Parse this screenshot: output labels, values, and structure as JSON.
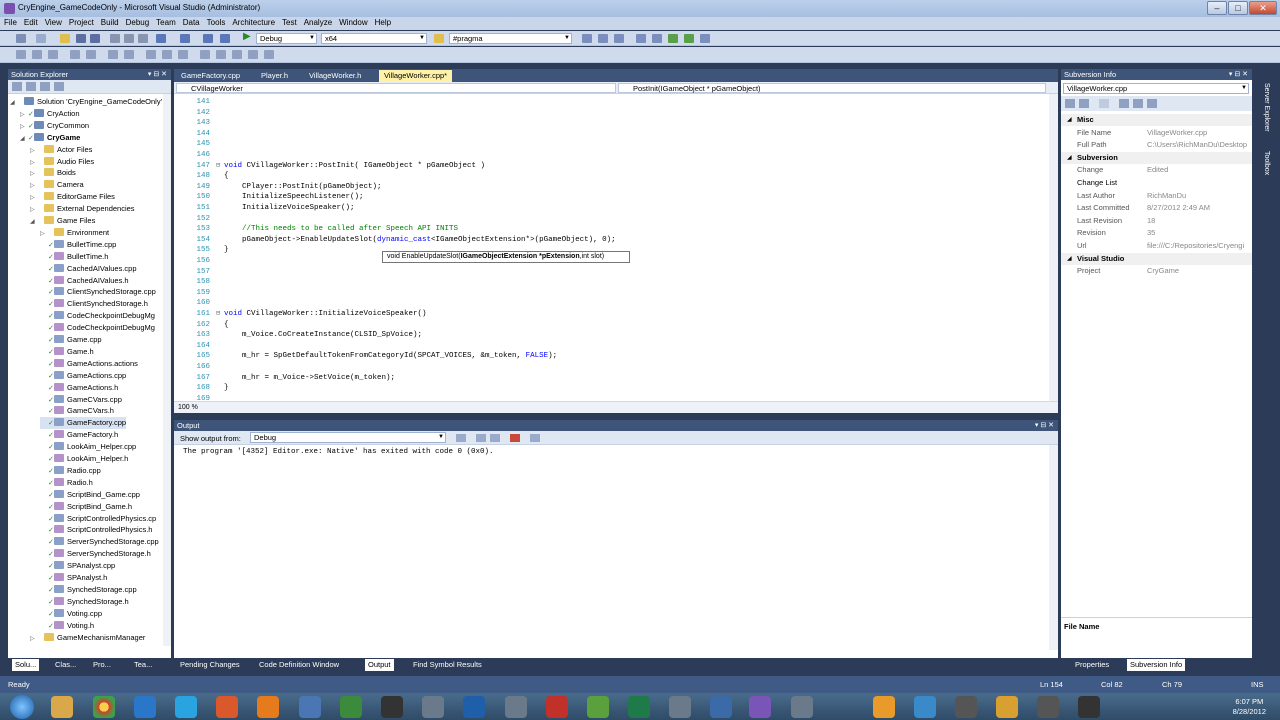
{
  "window": {
    "title": "CryEngine_GameCodeOnly - Microsoft Visual Studio (Administrator)"
  },
  "menu": [
    "File",
    "Edit",
    "View",
    "Project",
    "Build",
    "Debug",
    "Team",
    "Data",
    "Tools",
    "Architecture",
    "Test",
    "Analyze",
    "Window",
    "Help"
  ],
  "toolbar": {
    "config": "Debug",
    "platform": "x64",
    "find": "#pragma"
  },
  "solution_explorer": {
    "title": "Solution Explorer",
    "items": [
      {
        "label": "Solution 'CryEngine_GameCodeOnly' (3",
        "level": 0,
        "type": "proj",
        "expanded": true
      },
      {
        "label": "CryAction",
        "level": 1,
        "type": "proj",
        "check": true
      },
      {
        "label": "CryCommon",
        "level": 1,
        "type": "proj",
        "check": true
      },
      {
        "label": "CryGame",
        "level": 1,
        "type": "proj",
        "check": true,
        "expanded": true,
        "bold": true
      },
      {
        "label": "Actor Files",
        "level": 2,
        "type": "folder"
      },
      {
        "label": "Audio Files",
        "level": 2,
        "type": "folder"
      },
      {
        "label": "Boids",
        "level": 2,
        "type": "folder"
      },
      {
        "label": "Camera",
        "level": 2,
        "type": "folder"
      },
      {
        "label": "EditorGame Files",
        "level": 2,
        "type": "folder"
      },
      {
        "label": "External Dependencies",
        "level": 2,
        "type": "folder"
      },
      {
        "label": "Game Files",
        "level": 2,
        "type": "folder",
        "expanded": true
      },
      {
        "label": "Environment",
        "level": 3,
        "type": "folder"
      },
      {
        "label": "BulletTime.cpp",
        "level": 3,
        "type": "cpp",
        "check": true
      },
      {
        "label": "BulletTime.h",
        "level": 3,
        "type": "hfile",
        "check": true
      },
      {
        "label": "CachedAIValues.cpp",
        "level": 3,
        "type": "cpp",
        "check": true
      },
      {
        "label": "CachedAIValues.h",
        "level": 3,
        "type": "hfile",
        "check": true
      },
      {
        "label": "ClientSynchedStorage.cpp",
        "level": 3,
        "type": "cpp",
        "check": true
      },
      {
        "label": "ClientSynchedStorage.h",
        "level": 3,
        "type": "hfile",
        "check": true
      },
      {
        "label": "CodeCheckpointDebugMg",
        "level": 3,
        "type": "cpp",
        "check": true
      },
      {
        "label": "CodeCheckpointDebugMg",
        "level": 3,
        "type": "hfile",
        "check": true
      },
      {
        "label": "Game.cpp",
        "level": 3,
        "type": "cpp",
        "check": true
      },
      {
        "label": "Game.h",
        "level": 3,
        "type": "hfile",
        "check": true
      },
      {
        "label": "GameActions.actions",
        "level": 3,
        "type": "hfile",
        "check": true
      },
      {
        "label": "GameActions.cpp",
        "level": 3,
        "type": "cpp",
        "check": true
      },
      {
        "label": "GameActions.h",
        "level": 3,
        "type": "hfile",
        "check": true
      },
      {
        "label": "GameCVars.cpp",
        "level": 3,
        "type": "cpp",
        "check": true
      },
      {
        "label": "GameCVars.h",
        "level": 3,
        "type": "hfile",
        "check": true
      },
      {
        "label": "GameFactory.cpp",
        "level": 3,
        "type": "cpp",
        "check": true,
        "selected": true
      },
      {
        "label": "GameFactory.h",
        "level": 3,
        "type": "hfile",
        "check": true
      },
      {
        "label": "LookAim_Helper.cpp",
        "level": 3,
        "type": "cpp",
        "check": true
      },
      {
        "label": "LookAim_Helper.h",
        "level": 3,
        "type": "hfile",
        "check": true
      },
      {
        "label": "Radio.cpp",
        "level": 3,
        "type": "cpp",
        "check": true
      },
      {
        "label": "Radio.h",
        "level": 3,
        "type": "hfile",
        "check": true
      },
      {
        "label": "ScriptBind_Game.cpp",
        "level": 3,
        "type": "cpp",
        "check": true
      },
      {
        "label": "ScriptBind_Game.h",
        "level": 3,
        "type": "hfile",
        "check": true
      },
      {
        "label": "ScriptControlledPhysics.cp",
        "level": 3,
        "type": "cpp",
        "check": true
      },
      {
        "label": "ScriptControlledPhysics.h",
        "level": 3,
        "type": "hfile",
        "check": true
      },
      {
        "label": "ServerSynchedStorage.cpp",
        "level": 3,
        "type": "cpp",
        "check": true
      },
      {
        "label": "ServerSynchedStorage.h",
        "level": 3,
        "type": "hfile",
        "check": true
      },
      {
        "label": "SPAnalyst.cpp",
        "level": 3,
        "type": "cpp",
        "check": true
      },
      {
        "label": "SPAnalyst.h",
        "level": 3,
        "type": "hfile",
        "check": true
      },
      {
        "label": "SynchedStorage.cpp",
        "level": 3,
        "type": "cpp",
        "check": true
      },
      {
        "label": "SynchedStorage.h",
        "level": 3,
        "type": "hfile",
        "check": true
      },
      {
        "label": "Voting.cpp",
        "level": 3,
        "type": "cpp",
        "check": true
      },
      {
        "label": "Voting.h",
        "level": 3,
        "type": "hfile",
        "check": true
      },
      {
        "label": "GameMechanismManager",
        "level": 2,
        "type": "folder"
      }
    ],
    "bottom_tabs": [
      "Solu...",
      "Clas...",
      "Pro...",
      "Tea..."
    ]
  },
  "editor": {
    "tabs": [
      "GameFactory.cpp",
      "Player.h",
      "VillageWorker.h",
      "VillageWorker.cpp*"
    ],
    "active_tab": 3,
    "nav_left": "CVillageWorker",
    "nav_right": "PostInit(IGameObject * pGameObject)",
    "zoom": "100 %",
    "tooltip": {
      "prefix": "void EnableUpdateSlot(",
      "bold": "IGameObjectExtension *pExtension",
      "suffix": ",int slot)"
    },
    "lines": [
      {
        "n": "141",
        "t": ""
      },
      {
        "n": "142",
        "t": ""
      },
      {
        "n": "143",
        "t": ""
      },
      {
        "n": "144",
        "t": ""
      },
      {
        "n": "145",
        "t": ""
      },
      {
        "n": "146",
        "t": ""
      },
      {
        "n": "147",
        "t": "void CVillageWorker::PostInit( IGameObject * pGameObject )",
        "fold": true
      },
      {
        "n": "148",
        "t": "{"
      },
      {
        "n": "149",
        "t": "    CPlayer::PostInit(pGameObject);"
      },
      {
        "n": "150",
        "t": "    InitializeSpeechListener();"
      },
      {
        "n": "151",
        "t": "    InitializeVoiceSpeaker();"
      },
      {
        "n": "152",
        "t": ""
      },
      {
        "n": "153",
        "t": "    //This needs to be called after Speech API INITS",
        "comment": true
      },
      {
        "n": "154",
        "t": "    pGameObject->EnableUpdateSlot(dynamic_cast<IGameObjectExtension*>(pGameObject), 0);"
      },
      {
        "n": "155",
        "t": "}"
      },
      {
        "n": "156",
        "t": ""
      },
      {
        "n": "157",
        "t": ""
      },
      {
        "n": "158",
        "t": ""
      },
      {
        "n": "159",
        "t": ""
      },
      {
        "n": "160",
        "t": ""
      },
      {
        "n": "161",
        "t": "void CVillageWorker::InitializeVoiceSpeaker()",
        "fold": true
      },
      {
        "n": "162",
        "t": "{"
      },
      {
        "n": "163",
        "t": "    m_Voice.CoCreateInstance(CLSID_SpVoice);"
      },
      {
        "n": "164",
        "t": ""
      },
      {
        "n": "165",
        "t": "    m_hr = SpGetDefaultTokenFromCategoryId(SPCAT_VOICES, &m_token, FALSE);"
      },
      {
        "n": "166",
        "t": ""
      },
      {
        "n": "167",
        "t": "    m_hr = m_Voice->SetVoice(m_token);"
      },
      {
        "n": "168",
        "t": "}"
      },
      {
        "n": "169",
        "t": ""
      }
    ]
  },
  "output": {
    "title": "Output",
    "show_from_label": "Show output from:",
    "show_from_value": "Debug",
    "text": "The program '[4352] Editor.exe: Native' has exited with code 0 (0x0)."
  },
  "bottom_tabs": [
    "Pending Changes",
    "Code Definition Window",
    "Output",
    "Find Symbol Results"
  ],
  "svn": {
    "title": "Subversion Info",
    "combo": "VillageWorker.cpp",
    "sections": [
      {
        "name": "Misc",
        "rows": [
          {
            "k": "File Name",
            "v": "VillageWorker.cpp"
          },
          {
            "k": "Full Path",
            "v": "C:\\Users\\RichManDu\\Desktop"
          }
        ]
      },
      {
        "name": "Subversion",
        "rows": [
          {
            "k": "Change",
            "v": "Edited"
          },
          {
            "k": "Change List",
            "v": ""
          },
          {
            "k": "Last Author",
            "v": "RichManDu"
          },
          {
            "k": "Last Committed",
            "v": "8/27/2012 2:49 AM"
          },
          {
            "k": "Last Revision",
            "v": "18"
          },
          {
            "k": "Revision",
            "v": "35"
          },
          {
            "k": "Url",
            "v": "file:///C:/Repositories/Cryengi"
          }
        ]
      },
      {
        "name": "Visual Studio",
        "rows": [
          {
            "k": "Project",
            "v": "CryGame"
          }
        ]
      }
    ],
    "desc_title": "File Name",
    "bottom_tabs": [
      "Properties",
      "Subversion Info"
    ]
  },
  "side_strip": [
    "Server Explorer",
    "Toolbox"
  ],
  "status": {
    "ready": "Ready",
    "ln": "Ln 154",
    "col": "Col 82",
    "ch": "Ch 79",
    "mode": "INS"
  },
  "taskbar": {
    "time": "6:07 PM",
    "date": "8/28/2012"
  }
}
